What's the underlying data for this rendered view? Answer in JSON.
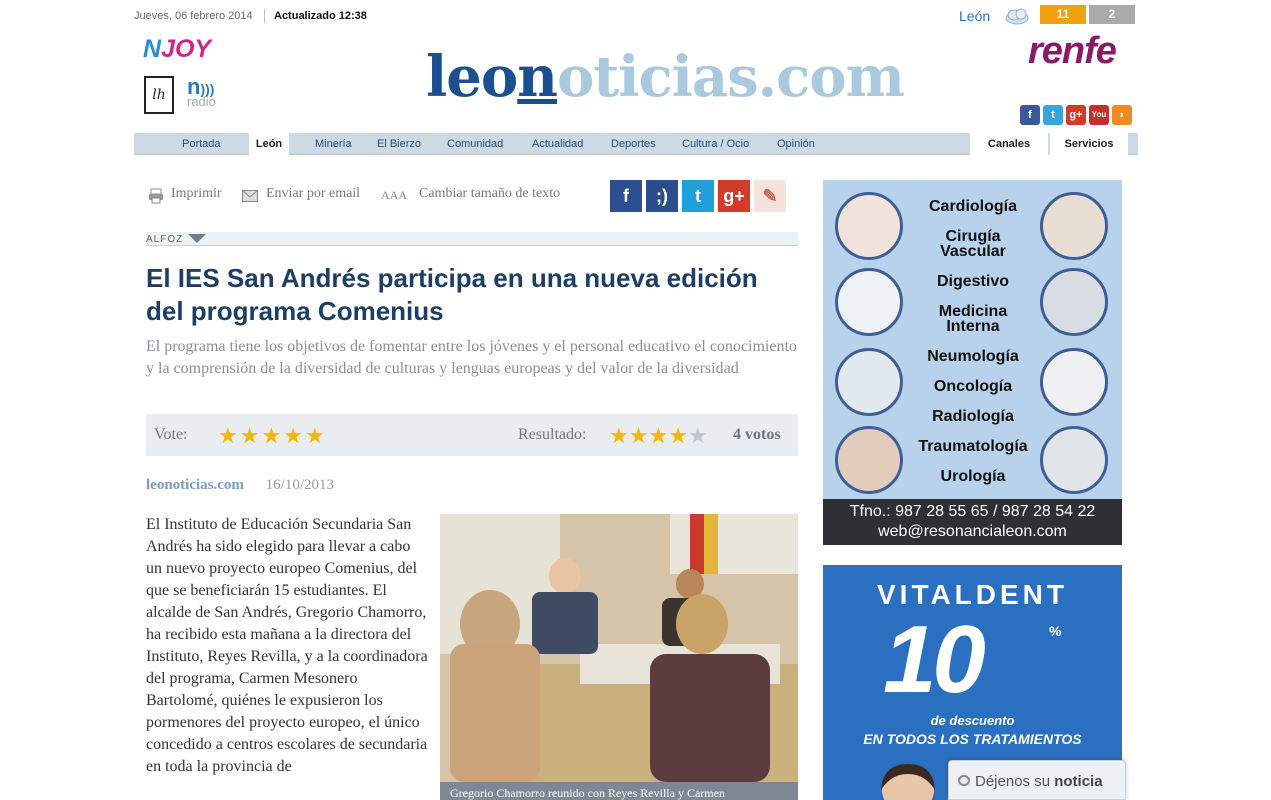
{
  "topbar": {
    "date": "Jueves, 06 febrero 2014",
    "updated": "Actualizado 12:38",
    "weather_city": "León",
    "weather_icon": "cloud-icon",
    "temp_high": "11",
    "temp_low": "2"
  },
  "logos": {
    "njoy_n": "N",
    "njoy_rest": "JOY",
    "lh": "lh",
    "nradio_n": "n",
    "nradio_label": "radio",
    "site_dark1": "leo",
    "site_dark2": "n",
    "site_light": "oticias.com",
    "renfe": "renfe"
  },
  "social_top": [
    "facebook-icon",
    "twitter-icon",
    "google-plus-icon",
    "youtube-icon",
    "rss-icon"
  ],
  "nav": {
    "items": [
      "Portada",
      "León",
      "Minería",
      "El Bierzo",
      "Comunidad",
      "Actualidad",
      "Deportes",
      "Cultura / Ocio",
      "Opinión"
    ],
    "active": "León",
    "right": [
      "Canales",
      "Servicios"
    ]
  },
  "tools": {
    "print": "Imprimir",
    "email": "Enviar por email",
    "text_size_icon": "AAA",
    "text_size": "Cambiar tamaño de texto"
  },
  "share_icons": [
    "facebook-icon",
    "meneame-icon",
    "twitter-icon",
    "google-plus-icon",
    "tuenti-icon"
  ],
  "article": {
    "section": "ALFOZ",
    "headline": "El IES San Andrés participa en una nueva edición del programa Comenius",
    "subhead": "El programa tiene los objetivos de fomentar entre los jóvenes y el personal educativo el conocimiento y la comprensión de la diversidad de culturas y lenguas europeas y del valor de la diversidad",
    "vote_label": "Vote:",
    "result_label": "Resultado:",
    "rating": 3.5,
    "votes": "4 votos",
    "source": "leonoticias.com",
    "date": "16/10/2013",
    "body": "El Instituto de Educación Secundaria San Andrés ha sido elegido para llevar a cabo un nuevo proyecto europeo Comenius, del que se beneficiarán 15 estudiantes. El alcalde de San Andrés, Gregorio Chamorro, ha recibido esta mañana a la directora del Instituto, Reyes Revilla, y a la coordinadora del programa, Carmen Mesonero Bartolomé, quiénes le expusieron los pormenores del proyecto europeo, el único concedido a centros escolares de secundaria en toda la provincia de",
    "photo_caption": "Gregorio Chamorro reunido con Reyes Revilla y Carmen"
  },
  "ad_resonancia": {
    "specialties": [
      "Cardiología",
      "Cirugía Vascular",
      "Digestivo",
      "Medicina Interna",
      "Neumología",
      "Oncología",
      "Radiología",
      "Traumatología",
      "Urología"
    ],
    "phone": "Tfno.: 987 28 55 65 / 987 28 54 22",
    "web": "web@resonancialeon.com"
  },
  "ad_vitaldent": {
    "brand": "VITALDENT",
    "percent": "10",
    "percent_sign": "%",
    "line1": "de descuento",
    "line2": "EN TODOS LOS TRATAMIENTOS"
  },
  "feedback": {
    "prefix": "Déjenos su",
    "highlight": "noticia"
  },
  "colors": {
    "nav_bg": "#cddae3",
    "logo_dark": "#1b4f8f",
    "logo_light": "#a9c9de",
    "temp_high_bg": "#f0a010",
    "star": "#f2b800"
  }
}
